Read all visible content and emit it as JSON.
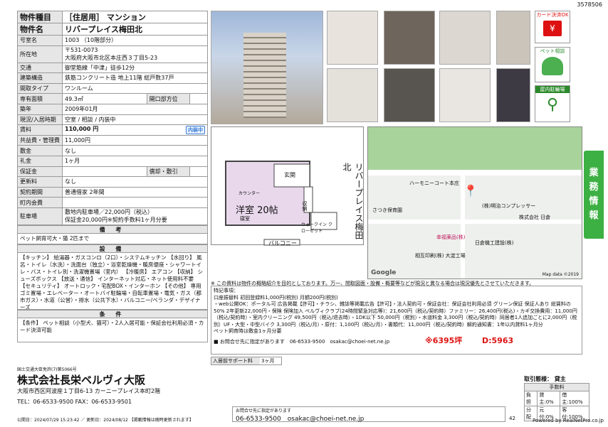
{
  "doc_id": "3578506",
  "specs": [
    {
      "k": "物件種目",
      "v": "［住居用］ マンション",
      "big": true
    },
    {
      "k": "物件名",
      "v": "リバープレイス梅田北",
      "big": true
    },
    {
      "k": "号室名",
      "v": "1003 （10階部分）"
    },
    {
      "k": "所在地",
      "v": "〒531-0073\n大阪府大阪市北区本庄西３丁目5-23"
    },
    {
      "k": "交通",
      "v": "御堂筋線「中津」徒歩12分"
    },
    {
      "k": "建築構造",
      "v": "鉄筋コンクリート造 地上11階 総戸数37戸"
    },
    {
      "k": "間取タイプ",
      "v": "ワンルーム"
    },
    {
      "k": "専有面積",
      "v": "49.3㎡",
      "k2": "開口部方位",
      "v2": ""
    },
    {
      "k": "築年",
      "v": "2009年01月"
    },
    {
      "k": "現況/入居時期",
      "v": "空室 / 相談 / 内装中"
    },
    {
      "k": "賃料",
      "v": "110,000 円",
      "badge": "内装中"
    },
    {
      "k": "共益費・管理費",
      "v": "11,000円"
    },
    {
      "k": "敷金",
      "v": "なし"
    },
    {
      "k": "礼金",
      "v": "1ヶ月"
    },
    {
      "k": "保証金",
      "v": "",
      "k2": "償却・敷引",
      "v2": ""
    },
    {
      "k": "更新料",
      "v": "なし"
    },
    {
      "k": "契約期間",
      "v": "普通借家 2年間"
    },
    {
      "k": "町内会費",
      "v": ""
    },
    {
      "k": "駐車場",
      "v": "敷地内駐車場／22,000円（税込）\n保証金20,000円※契約手数料1ヶ月分要"
    }
  ],
  "biko_title": "備 考",
  "biko": "ペット飼育可大・猫 2匹まで",
  "setsubi_title": "設 備",
  "setsubi": "【キッチン】 給湯器・ガスコンロ（2口）・システムキッチン 【水回り】 風呂・トイレ（水洗）・洗面台（独立）・浴室乾燥機・暖房便座・シャワートイレ・バス・トイレ別・洗濯機置場（室内） 【冷暖房】 エアコン 【収納】 シューズボックス 【放送・通信】 インターネット対応・ネット使用料不要 【セキュリティ】 オートロック・宅配BOX・インターホン 【その他】 専用ゴミ置場・エレベーター・オートバイ駐輪場・自転車置場・電気・ガス（都市ガス）・水道（公営）・排水（公共下水）・バルコニー/ベランダ・デザイナーズ",
  "joken_title": "条 件",
  "joken": "【条件】 ペット相談（小型犬、猫可）・2人入居可能・保証会社利用必須・カード決済可能",
  "floor": {
    "room": "洋室 20帖",
    "sub": "寝室",
    "kitchen": "カウンター",
    "entry": "玄関",
    "closet": "収納",
    "wic": "ウォークイン クローゼット",
    "veranda": "バルコニー",
    "name": "リバープレイス梅田北"
  },
  "map": {
    "labels": [
      "ハーモニーコート本庄",
      "さつき保育園",
      "(株)明治コンプレッサー",
      "株式会社 日倉",
      "幸福薬品(株)",
      "日倉機工建設(株)",
      "相互印刷(株) 大淀工場"
    ],
    "credit": "Map data ©2019",
    "logo": "Google"
  },
  "notice": "※ この資料は物件の概略紹介を目的としております。万一、間取図面・設備・概要等などが現況と異なる場合は現況優先とさせていただきます。",
  "remarks_title": "特記事項：",
  "remarks": "口座振替料 初回登録料1,000円(税別) 月額200円(税別)\n・web公開OK：ポータル可 広告掲載【許可】・チラシ、雑誌等掲載広告【許可】・法人契約可・保証会社：保証会社利用必須 グリーン保証 保証人あり 総賃料の50% 2年更新22,000円・保険 保険加入 ペルヴィクラブ(24時間緊急対応等)：21,600円（税込/契約時）ファミリー：26,400円(税込)・カギ交換費用：11,000円（税込/契約時）・室内クリーニング 49,500円（税込/退去時）・1DK以下 50,000円（税別）・水道料金 3,300円（税込/契約時）同居者1人追加ごとに2,000円（税別）UF・大型・中型バイク 3,300円（税込/月）・原付：1,100円（税込/月）・書類代：11,000円（税込/契約時）解約通知書：1年以内貸料1ヶ月分\nペット飼育時は敷金1ヶ月分要",
  "contact": "お問合せ先に指定があります",
  "contact_tel": "06-6533-9500",
  "contact_mail": "osakac@choei-net.ne.jp",
  "area_code": "※6395坪",
  "d_code": "D:5963",
  "support_label": "入居前サポート料",
  "support_val": "3ヶ月",
  "license": "国土交通大臣免許(7)第5066号",
  "company": "株式会社長栄ベルヴィ大阪",
  "address": "大阪市西区阿波座１丁目6-13 カーニープレイス本町2階",
  "tel": "TEL：06-6533-9500 FAX：06-6533-9501",
  "dates": "公開日：2024/07/29 15:23:42 ／ 更新日：2024/08/12 【掲載情報は随時更新されます】",
  "copy_head": "お問合せ先に指定があります",
  "copy_tel": "06-6533-9500",
  "copy_mail": "osakac@choei-net.ne.jp",
  "page": "42",
  "torihiki_title": "取引態様：",
  "torihiki_val": "貸主",
  "fee_head": "手数料",
  "fee_rows": [
    [
      "負担",
      "貸主:0%",
      "借主:100%"
    ],
    [
      "分配",
      "元付:0%",
      "客付:100%"
    ]
  ],
  "powered": "Powered by RealNetPro.co.jp",
  "side": [
    "業",
    "務",
    "情",
    "報"
  ],
  "icons": [
    "カード決済OK",
    "ペット相談",
    "屋内駐輪場"
  ]
}
